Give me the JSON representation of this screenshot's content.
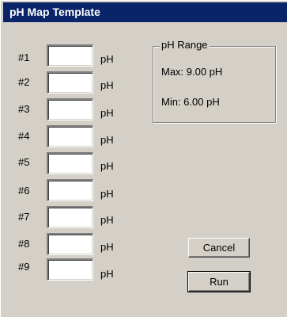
{
  "window": {
    "title": "pH Map Template"
  },
  "rows": [
    {
      "label": "#1",
      "value": "",
      "unit": "pH"
    },
    {
      "label": "#2",
      "value": "",
      "unit": "pH"
    },
    {
      "label": "#3",
      "value": "",
      "unit": "pH"
    },
    {
      "label": "#4",
      "value": "",
      "unit": "pH"
    },
    {
      "label": "#5",
      "value": "",
      "unit": "pH"
    },
    {
      "label": "#6",
      "value": "",
      "unit": "pH"
    },
    {
      "label": "#7",
      "value": "",
      "unit": "pH"
    },
    {
      "label": "#8",
      "value": "",
      "unit": "pH"
    },
    {
      "label": "#9",
      "value": "",
      "unit": "pH"
    }
  ],
  "ph_range": {
    "legend": "pH Range",
    "max": "Max: 9.00 pH",
    "min": "Min: 6.00 pH"
  },
  "buttons": {
    "cancel": "Cancel",
    "run": "Run"
  }
}
